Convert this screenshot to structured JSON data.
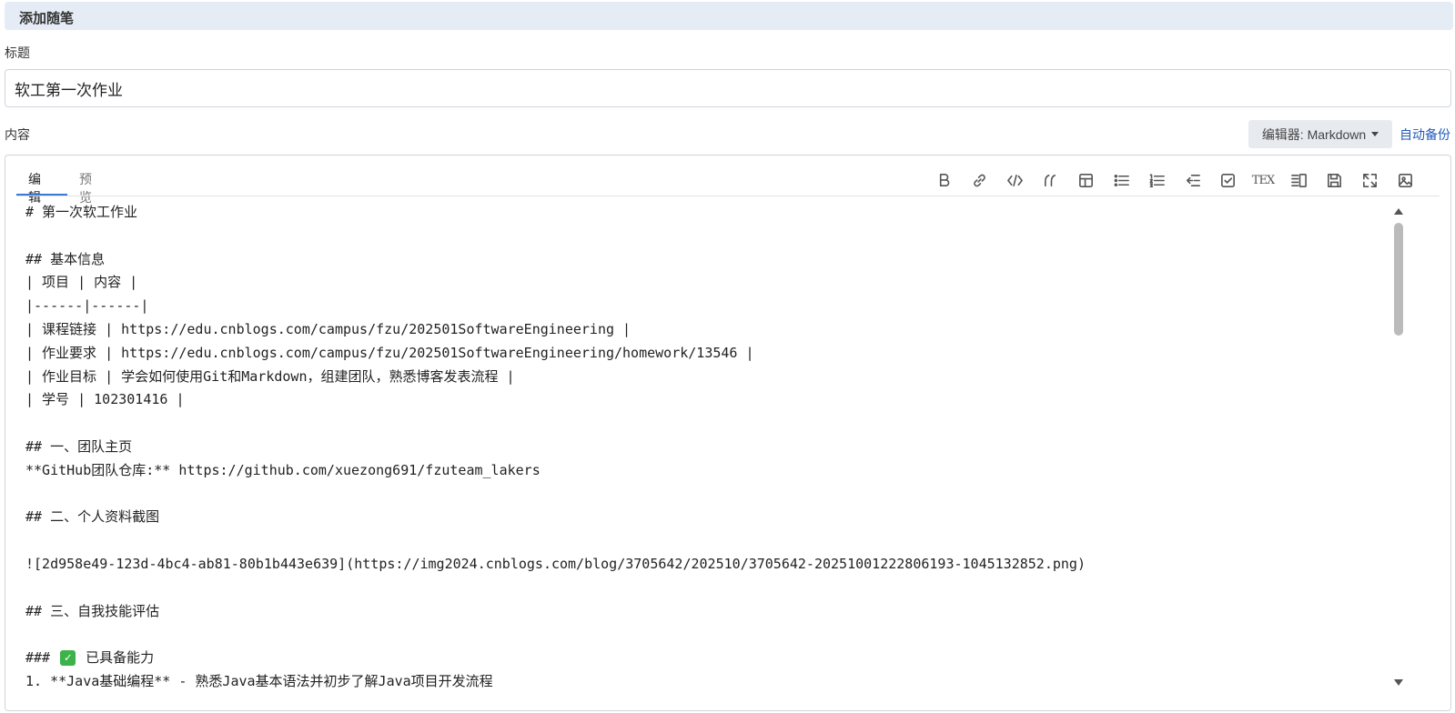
{
  "header": {
    "title": "添加随笔"
  },
  "title_field": {
    "label": "标题",
    "value": "软工第一次作业"
  },
  "content": {
    "label": "内容",
    "editor_select": "编辑器: Markdown",
    "auto_backup": "自动备份"
  },
  "tabs": [
    {
      "label": "编辑",
      "active": true
    },
    {
      "label": "预览",
      "active": false
    }
  ],
  "toolbar": {
    "icons": [
      "bold-icon",
      "link-icon",
      "code-icon",
      "quote-icon",
      "table-icon",
      "bullet-list-icon",
      "ordered-list-icon",
      "outdent-icon",
      "checkbox-icon",
      "tex-icon",
      "preview-split-icon",
      "save-icon",
      "fullscreen-icon",
      "image-icon"
    ],
    "tex_label": "TEX"
  },
  "editor_lines": [
    "# 第一次软工作业",
    "",
    "## 基本信息",
    "| 项目 | 内容 |",
    "|------|------|",
    "| 课程链接 | https://edu.cnblogs.com/campus/fzu/202501SoftwareEngineering |",
    "| 作业要求 | https://edu.cnblogs.com/campus/fzu/202501SoftwareEngineering/homework/13546 |",
    "| 作业目标 | 学会如何使用Git和Markdown，组建团队，熟悉博客发表流程 |",
    "| 学号 | 102301416 |",
    "",
    "## 一、团队主页",
    "**GitHub团队仓库:** https://github.com/xuezong691/fzuteam_lakers",
    "",
    "## 二、个人资料截图",
    "",
    "![2d958e49-123d-4bc4-ab81-80b1b443e639](https://img2024.cnblogs.com/blog/3705642/202510/3705642-20251001222806193-1045132852.png)",
    "",
    "## 三、自我技能评估",
    "",
    "### ",
    "1. **Java基础编程** - 熟悉Java基本语法并初步了解Java项目开发流程"
  ],
  "check_line": {
    "prefix": "### ",
    "emoji": "✓",
    "text": "已具备能力"
  },
  "colors": {
    "accent": "#3a79d6",
    "header_bg": "#e5ecf5",
    "link": "#1f5bb8",
    "check": "#3bb34a"
  }
}
